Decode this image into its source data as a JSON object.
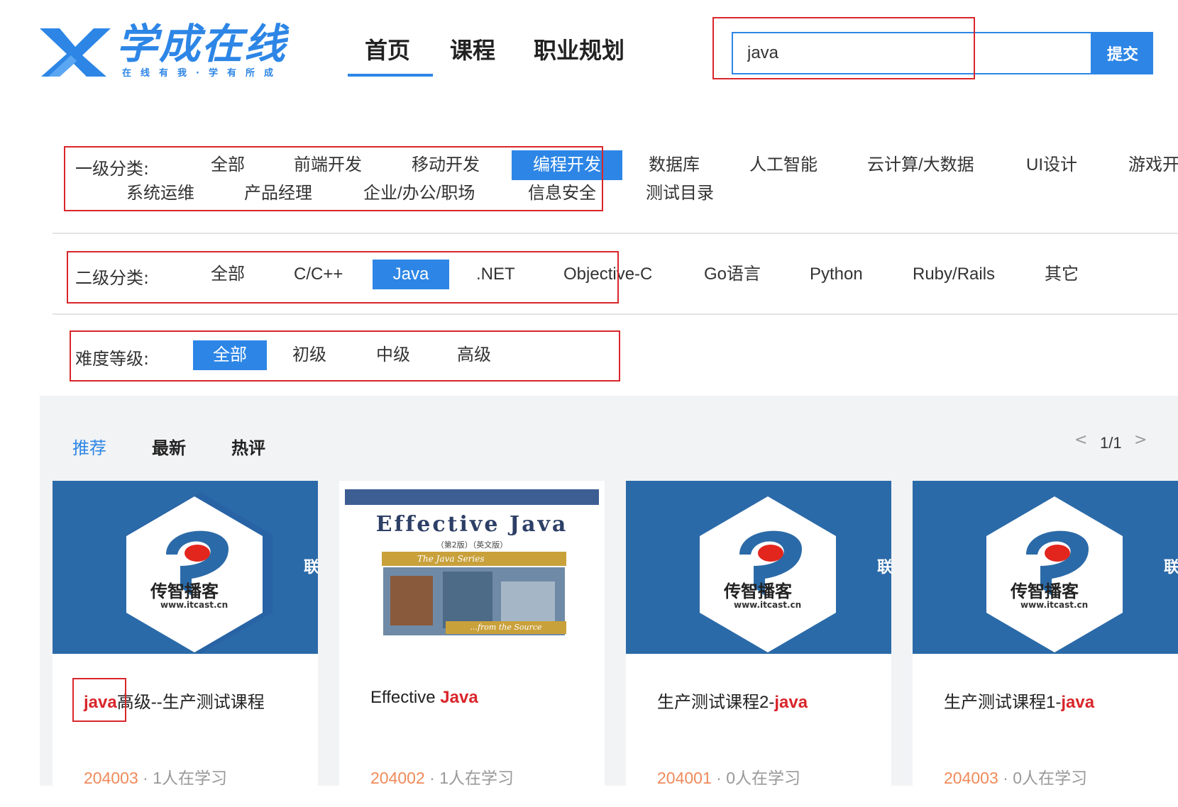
{
  "logo": {
    "name": "学成在线",
    "slogan": "在线有我·学有所成",
    "color": "#2d86e6"
  },
  "nav": {
    "items": [
      {
        "label": "首页",
        "active": true
      },
      {
        "label": "课程",
        "active": false
      },
      {
        "label": "职业规划",
        "active": false
      }
    ]
  },
  "search": {
    "value": "java",
    "button_label": "提交"
  },
  "filters": {
    "level1": {
      "label": "一级分类:",
      "options": [
        "全部",
        "前端开发",
        "移动开发",
        "编程开发",
        "数据库",
        "人工智能",
        "云计算/大数据",
        "UI设计",
        "游戏开",
        "系统运维",
        "产品经理",
        "企业/办公/职场",
        "信息安全",
        "测试目录"
      ],
      "selected": "编程开发"
    },
    "level2": {
      "label": "二级分类:",
      "options": [
        "全部",
        "C/C++",
        "Java",
        ".NET",
        "Objective-C",
        "Go语言",
        "Python",
        "Ruby/Rails",
        "其它"
      ],
      "selected": "Java"
    },
    "difficulty": {
      "label": "难度等级:",
      "options": [
        "全部",
        "初级",
        "中级",
        "高级"
      ],
      "selected": "全部"
    }
  },
  "sort_tabs": [
    {
      "label": "推荐",
      "active": true
    },
    {
      "label": "最新",
      "active": false
    },
    {
      "label": "热评",
      "active": false
    }
  ],
  "pager": {
    "prev": "<",
    "text": "1/1",
    "next": ">"
  },
  "courses": [
    {
      "thumb": "itcast-logo",
      "brand": "传智播客",
      "url": "www.itcast.cn",
      "side_char": "联",
      "title_keyword": "java",
      "title_rest": "高级--生产测试课程",
      "code": "204003",
      "learners": " · 1人在学习"
    },
    {
      "thumb": "book-cover",
      "book_title": "Effective Java",
      "book_edition": "（第2版）（英文版）",
      "book_series": "The Java Series",
      "book_footer": "...from the Source",
      "title_prefix": "Effective ",
      "title_keyword": "Java",
      "code": "204002",
      "learners": " · 1人在学习"
    },
    {
      "thumb": "itcast-logo",
      "brand": "传智播客",
      "url": "www.itcast.cn",
      "side_char": "联",
      "title_prefix": "生产测试课程2-",
      "title_keyword": "java",
      "code": "204001",
      "learners": " · 0人在学习"
    },
    {
      "thumb": "itcast-logo",
      "brand": "传智播客",
      "url": "www.itcast.cn",
      "side_char": "联",
      "title_prefix": "生产测试课程1-",
      "title_keyword": "java",
      "code": "204003",
      "learners": " · 0人在学习"
    }
  ],
  "colors": {
    "accent": "#2d86e6",
    "annotation": "#d9262b",
    "keyword": "#d9262b",
    "code": "#f08a5a",
    "thumb_bg": "#2b6aa8"
  }
}
